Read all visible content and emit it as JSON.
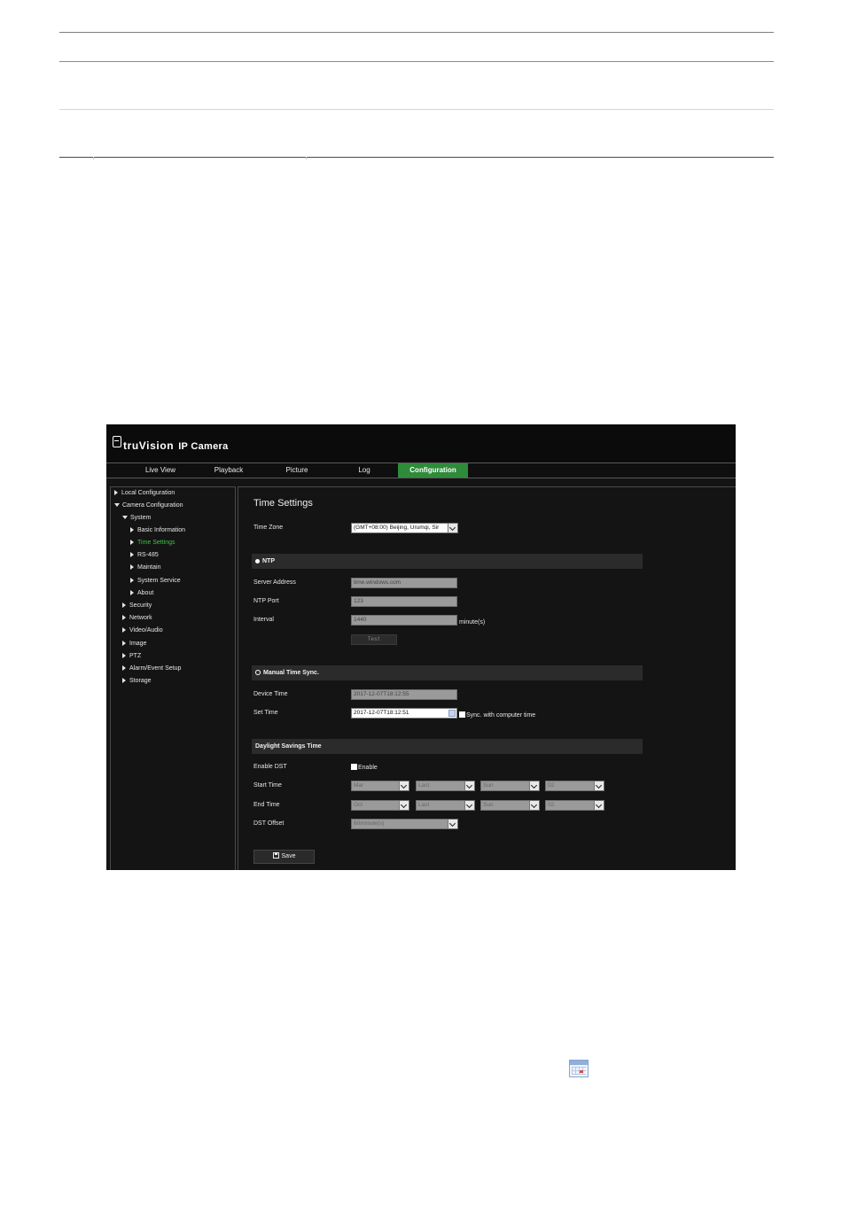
{
  "document": {},
  "app": {
    "brand": "truVision",
    "product": "IP Camera",
    "tabs": [
      "Live View",
      "Playback",
      "Picture",
      "Log",
      "Configuration"
    ],
    "active_tab": "Configuration",
    "sidebar": {
      "local_configuration": "Local Configuration",
      "camera_configuration": "Camera Configuration",
      "system": "System",
      "system_items": [
        "Basic Information",
        "Time Settings",
        "RS-485",
        "Maintain",
        "System Service",
        "About"
      ],
      "active_item": "Time Settings",
      "categories": [
        "Security",
        "Network",
        "Video/Audio",
        "Image",
        "PTZ",
        "Alarm/Event Setup",
        "Storage"
      ]
    },
    "page_title": "Time Settings",
    "time_zone": {
      "label": "Time Zone",
      "value": "(GMT+08:00) Beijing, Urumqi, Sir"
    },
    "ntp": {
      "title": "NTP",
      "server_label": "Server Address",
      "server_value": "time.windows.com",
      "port_label": "NTP Port",
      "port_value": "123",
      "interval_label": "Interval",
      "interval_value": "1440",
      "interval_unit": "minute(s)",
      "test_button": "Test"
    },
    "manual": {
      "title": "Manual Time Sync.",
      "device_time_label": "Device Time",
      "device_time_value": "2017-12-07T18:12:55",
      "set_time_label": "Set Time",
      "set_time_value": "2017-12-07T18:12:51",
      "sync_label": "Sync. with computer time"
    },
    "dst": {
      "title": "Daylight Savings Time",
      "enable_label": "Enable DST",
      "enable_checkbox_label": "Enable",
      "start_label": "Start Time",
      "start": [
        "Mar",
        "Last",
        "Sun",
        "02"
      ],
      "end_label": "End Time",
      "end": [
        "Oct",
        "Last",
        "Sun",
        "02"
      ],
      "offset_label": "DST Offset",
      "offset_value": "60minute(s)"
    },
    "save_button": "Save"
  },
  "colors": {
    "accent": "#2e8b3a",
    "active_text": "#3ec24a",
    "background": "#141414"
  }
}
